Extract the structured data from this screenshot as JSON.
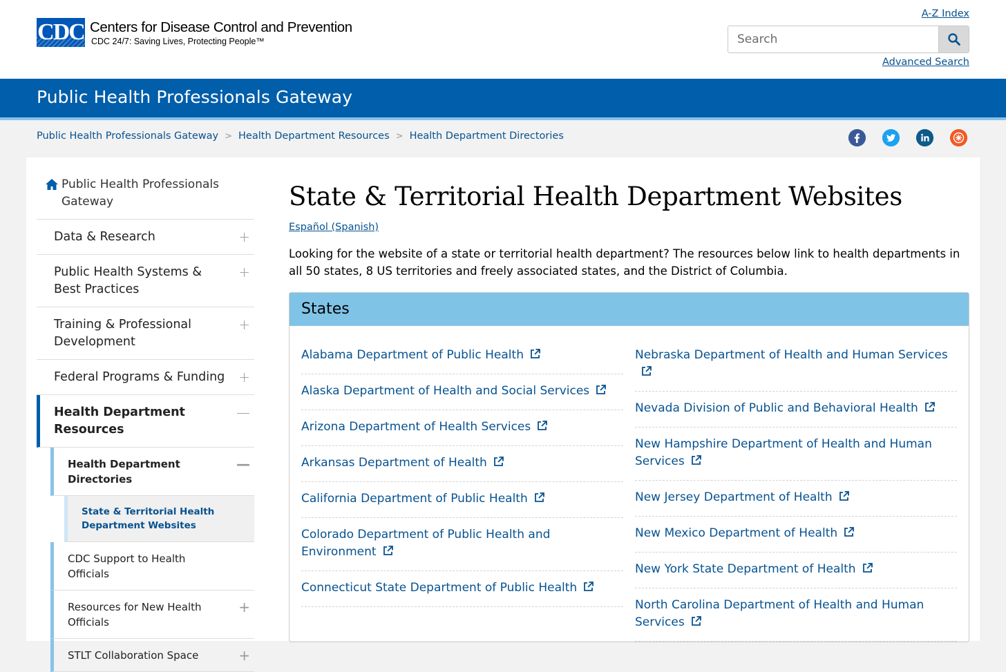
{
  "header": {
    "logo_mark": "CDC",
    "logo_name": "Centers for Disease Control and Prevention",
    "logo_tagline": "CDC 24/7: Saving Lives, Protecting People™",
    "az_index": "A-Z Index",
    "search_placeholder": "Search",
    "advanced_search": "Advanced Search"
  },
  "band": {
    "title": "Public Health Professionals Gateway"
  },
  "breadcrumb": [
    "Public Health Professionals Gateway",
    "Health Department Resources",
    "Health Department Directories"
  ],
  "social": [
    "facebook-icon",
    "twitter-icon",
    "linkedin-icon",
    "syndicate-icon"
  ],
  "colors": {
    "brand_blue": "#005eaa",
    "link": "#075290",
    "card_header": "#7fc3e7",
    "accent_light": "#88c3ea"
  },
  "sidebar": {
    "home": "Public Health Professionals Gateway",
    "items": [
      {
        "label": "Data & Research",
        "toggle": "+"
      },
      {
        "label": "Public Health Systems & Best Practices",
        "toggle": "+"
      },
      {
        "label": "Training & Professional Development",
        "toggle": "+"
      },
      {
        "label": "Federal Programs & Funding",
        "toggle": "+"
      },
      {
        "label": "Health Department Resources",
        "toggle": "—"
      }
    ],
    "sub_items": [
      {
        "label": "Health Department Directories",
        "toggle": "—"
      },
      {
        "label": "State & Territorial Health Department Websites"
      },
      {
        "label": "CDC Support to Health Officials"
      },
      {
        "label": "Resources for New Health Officials",
        "toggle": "+"
      },
      {
        "label": "STLT Collaboration Space",
        "toggle": "+"
      }
    ]
  },
  "main": {
    "title": "State & Territorial Health Department Websites",
    "spanish_link": "Español (Spanish)",
    "intro": "Looking for the website of a state or territorial health department? The resources below link to health departments in all 50 states, 8 US territories and freely associated states, and the District of Columbia.",
    "card_title": "States",
    "left_links": [
      "Alabama Department of Public Health",
      "Alaska Department of Health and Social Services",
      "Arizona Department of Health Services",
      "Arkansas Department of Health",
      "California Department of Public Health",
      "Colorado Department of Public Health and Environment",
      "Connecticut State Department of Public Health"
    ],
    "right_links": [
      "Nebraska Department of Health and Human Services",
      "Nevada Division of Public and Behavioral Health",
      "New Hampshire Department of Health and Human Services",
      "New Jersey Department of Health",
      "New Mexico Department of Health",
      "New York State Department of Health",
      "North Carolina Department of Health and Human Services"
    ]
  }
}
